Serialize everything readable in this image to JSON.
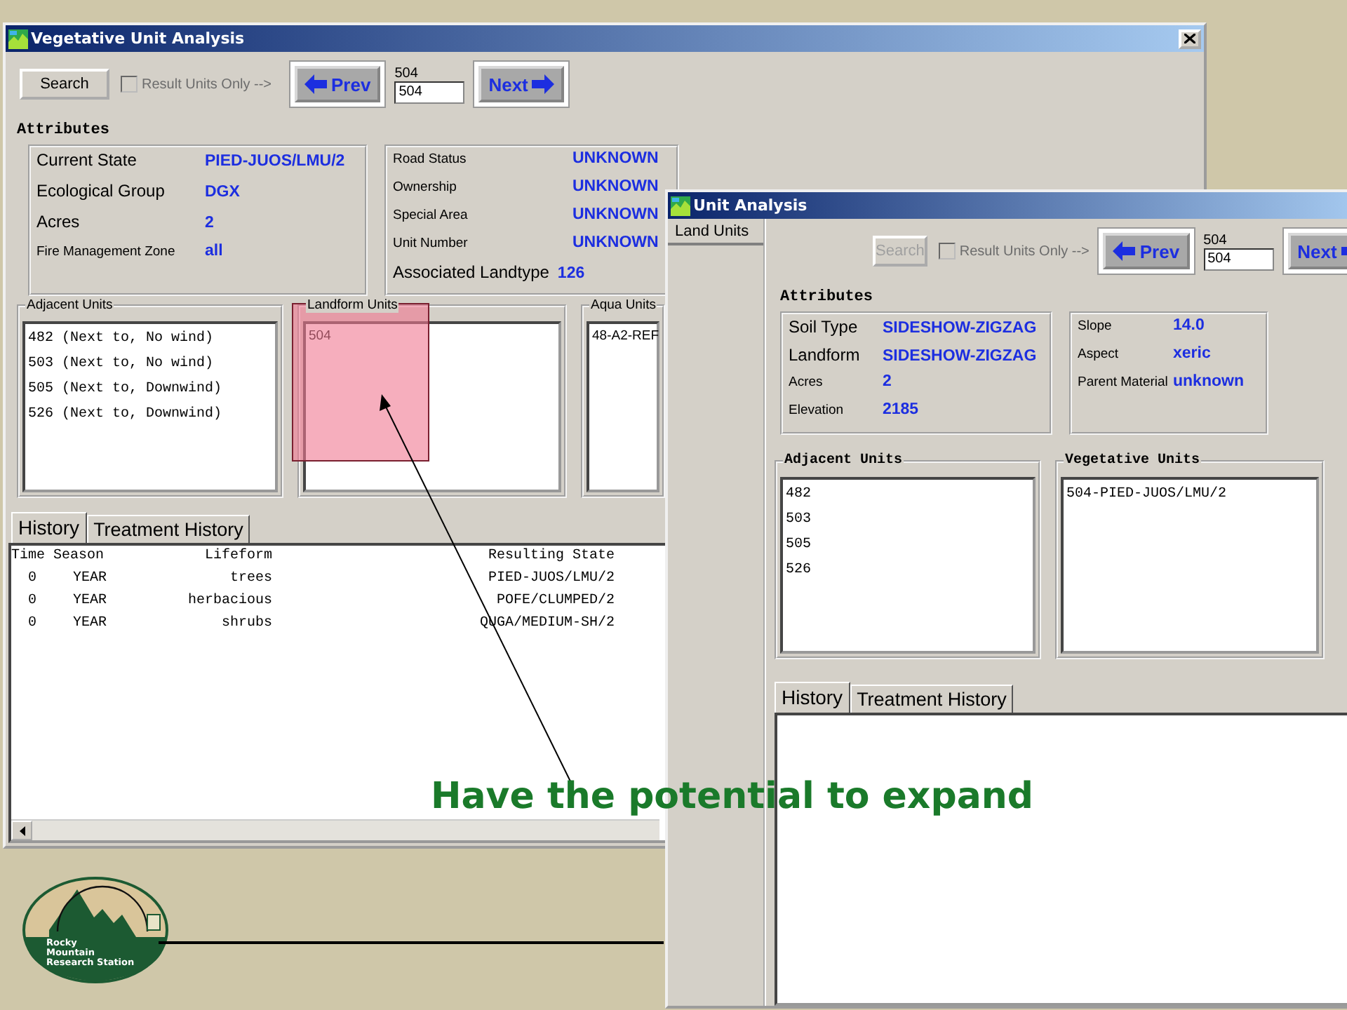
{
  "windows": [
    {
      "title": "Vegetative Unit Analysis",
      "toolbar": {
        "search": {
          "label": "Search",
          "disabled": false
        },
        "result_only": {
          "label": "Result Units Only -->",
          "checked": false,
          "disabled": true
        },
        "prev": "Prev",
        "unit_label": "504",
        "unit_value": "504",
        "next": "Next"
      },
      "attributes_heading": "Attributes",
      "attribute_groups": [
        {
          "fields": [
            {
              "label": "Current State",
              "value": "PIED-JUOS/LMU/2",
              "kind": "large"
            },
            {
              "label": "Ecological Group",
              "value": "DGX",
              "kind": "large"
            },
            {
              "label": "Acres",
              "value": "2",
              "kind": "large"
            },
            {
              "label": "Fire Management Zone",
              "value": "all",
              "kind": "small"
            }
          ]
        },
        {
          "fields": [
            {
              "label": "Road Status",
              "value": "UNKNOWN",
              "kind": "small"
            },
            {
              "label": "Ownership",
              "value": "UNKNOWN",
              "kind": "small"
            },
            {
              "label": "Special Area",
              "value": "UNKNOWN",
              "kind": "small"
            },
            {
              "label": "Unit Number",
              "value": "UNKNOWN",
              "kind": "small"
            },
            {
              "label": "Associated Landtype",
              "value": "126",
              "kind": "large"
            }
          ]
        }
      ],
      "lists": [
        {
          "title": "Adjacent Units",
          "items": [
            "482 (Next to, No wind)",
            "503 (Next to, No wind)",
            "505 (Next to, Downwind)",
            "526 (Next to, Downwind)"
          ]
        },
        {
          "title": "Landform Units",
          "items": [
            "504"
          ]
        },
        {
          "title": "Aqua Units",
          "items": [
            "48-A2-REF"
          ]
        }
      ],
      "tabs": [
        {
          "label": "History",
          "selected": true
        },
        {
          "label": "Treatment History",
          "selected": false
        }
      ],
      "history_table": {
        "columns": [
          "Time",
          "Season",
          "Lifeform",
          "Resulting State"
        ],
        "rows": [
          [
            "0",
            "YEAR",
            "trees",
            "PIED-JUOS/LMU/2"
          ],
          [
            "0",
            "YEAR",
            "herbacious",
            "POFE/CLUMPED/2"
          ],
          [
            "0",
            "YEAR",
            "shrubs",
            "QUGA/MEDIUM-SH/2"
          ]
        ]
      }
    },
    {
      "title": "Unit Analysis",
      "side_tabs": [
        {
          "label": "Land Units",
          "selected": true
        }
      ],
      "toolbar": {
        "search": {
          "label": "Search",
          "disabled": true
        },
        "result_only": {
          "label": "Result Units Only -->",
          "checked": false,
          "disabled": true
        },
        "prev": "Prev",
        "unit_label": "504",
        "unit_value": "504",
        "next": "Next"
      },
      "attributes_heading": "Attributes",
      "attribute_groups": [
        {
          "fields": [
            {
              "label": "Soil Type",
              "value": "SIDESHOW-ZIGZAG",
              "kind": "large"
            },
            {
              "label": "Landform",
              "value": "SIDESHOW-ZIGZAG",
              "kind": "large"
            },
            {
              "label": "Acres",
              "value": "2",
              "kind": "small"
            },
            {
              "label": "Elevation",
              "value": "2185",
              "kind": "small"
            }
          ]
        },
        {
          "fields": [
            {
              "label": "Slope",
              "value": "14.0",
              "kind": "small"
            },
            {
              "label": "Aspect",
              "value": "xeric",
              "kind": "small"
            },
            {
              "label": "Parent Material",
              "value": "unknown",
              "kind": "small"
            }
          ]
        }
      ],
      "lists": [
        {
          "title": "Adjacent Units",
          "items": [
            "482",
            "503",
            "505",
            "526"
          ]
        },
        {
          "title": "Vegetative Units",
          "items": [
            "504-PIED-JUOS/LMU/2"
          ]
        }
      ],
      "tabs": [
        {
          "label": "History",
          "selected": true
        },
        {
          "label": "Treatment History",
          "selected": false
        }
      ]
    }
  ],
  "caption": "Have the potential to expand",
  "logo_lines": [
    "Rocky",
    "Mountain",
    "Research Station"
  ]
}
